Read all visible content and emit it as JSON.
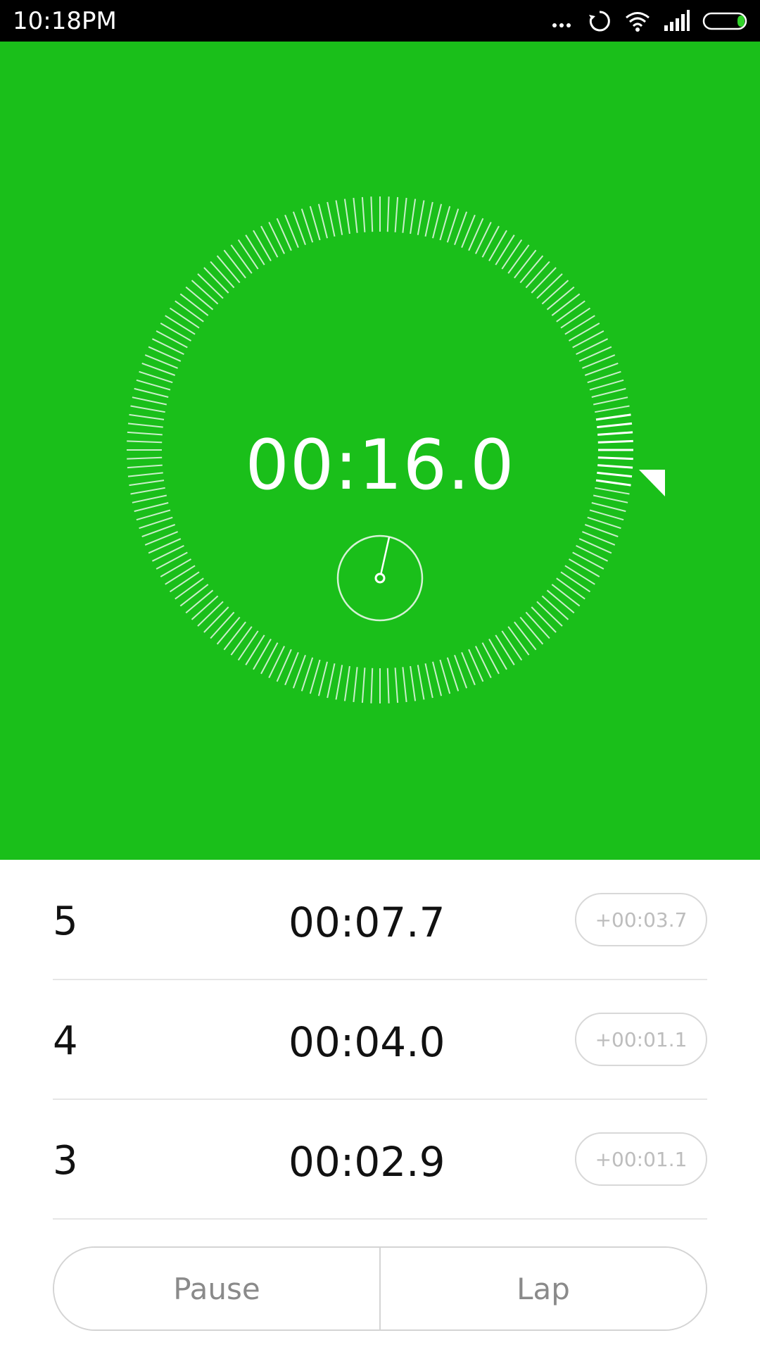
{
  "status_bar": {
    "time": "10:18PM",
    "icons": [
      "more-dots-icon",
      "sync-icon",
      "wifi-icon",
      "signal-icon",
      "battery-icon"
    ],
    "battery_color": "#31D22A"
  },
  "stopwatch": {
    "elapsed": "00:16.0",
    "background_color": "#1ABF1A"
  },
  "laps": [
    {
      "number": "5",
      "time": "00:07.7",
      "diff": "+00:03.7"
    },
    {
      "number": "4",
      "time": "00:04.0",
      "diff": "+00:01.1"
    },
    {
      "number": "3",
      "time": "00:02.9",
      "diff": "+00:01.1"
    }
  ],
  "controls": {
    "pause_label": "Pause",
    "lap_label": "Lap"
  }
}
